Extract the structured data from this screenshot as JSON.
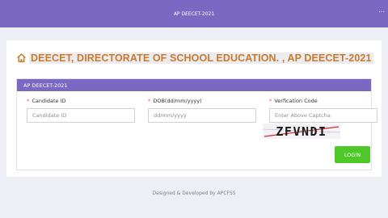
{
  "topbar": {
    "title": "AP DEECET-2021",
    "menu_glyph": "⋯"
  },
  "heading": {
    "icon": "home-icon",
    "text": "DEECET, DIRECTORATE OF SCHOOL EDUCATION. , AP DEECET-2021"
  },
  "panel": {
    "title": "AP DEECET-2021",
    "fields": [
      {
        "required_mark": "*",
        "label": "Candidate ID",
        "placeholder": "Candidate ID",
        "value": ""
      },
      {
        "required_mark": "*",
        "label": "DOB(dd/mm/yyyy)",
        "placeholder": "dd/mm/yyyy",
        "value": ""
      },
      {
        "required_mark": "*",
        "label": "Verfication Code",
        "placeholder": "Enter Above Captcha",
        "value": ""
      }
    ],
    "captcha_text": "ZFVNDI",
    "login_label": "LOGIN"
  },
  "footer": {
    "text": "Designed & Developed by APCFSS"
  },
  "colors": {
    "brand": "#7b68c2",
    "heading": "#c8792e",
    "login": "#4ec728",
    "required": "#d9534f"
  }
}
